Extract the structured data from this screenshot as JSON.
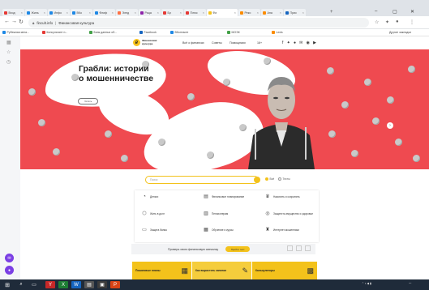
{
  "browser": {
    "tabs": [
      {
        "label": "Вход",
        "color": "#e53935"
      },
      {
        "label": "Жиль",
        "color": "#1e88e5"
      },
      {
        "label": "Инфо",
        "color": "#1e88e5"
      },
      {
        "label": "ВКо",
        "color": "#1e88e5"
      },
      {
        "label": "Флиф",
        "color": "#1e88e5"
      },
      {
        "label": "Элед",
        "color": "#ff7043"
      },
      {
        "label": "Раца",
        "color": "#8e24aa"
      },
      {
        "label": "Бр",
        "color": "#e53935"
      },
      {
        "label": "Плюс",
        "color": "#e53935"
      },
      {
        "label": "Фи",
        "color": "#f3c21b"
      },
      {
        "label": "Реко",
        "color": "#fb8c00"
      },
      {
        "label": "Ана",
        "color": "#fb8c00"
      },
      {
        "label": "Прис",
        "color": "#1565c0"
      }
    ],
    "new_tab": "+",
    "url_domain": "fincult.info",
    "url_separator": "|",
    "url_title": "Финансовая культура",
    "bookmarks": [
      {
        "label": "Рубежная мега...",
        "color": "#1e88e5"
      },
      {
        "label": "Консультант п...",
        "color": "#e53935"
      },
      {
        "label": "Банк данных об...",
        "color": "#43a047"
      },
      {
        "label": "Facebook",
        "color": "#1565c0"
      },
      {
        "label": "ВКонтакте",
        "color": "#1e88e5"
      },
      {
        "label": "МОЭК",
        "color": "#43a047"
      },
      {
        "label": "Lexis",
        "color": "#fb8c00"
      }
    ],
    "other_bookmarks": "Другие закладки"
  },
  "site": {
    "logo_mark": "₽",
    "logo_line1": "Финансовая",
    "logo_line2": "культура",
    "nav": [
      "Всё о финансах",
      "Советы",
      "Помощники",
      "16+"
    ],
    "social": "f ✦ ● ✉ ◉ ▶",
    "hero": {
      "title_line1": "Грабли: истории",
      "title_line2": "о мошенничестве",
      "button": "Читать"
    },
    "search": {
      "placeholder": "Поиск",
      "options": [
        "Всё",
        "Тесты"
      ]
    },
    "categories": [
      {
        "icon": "◔",
        "label": "Деньги"
      },
      {
        "icon": "▤",
        "label": "Финансовое планирование"
      },
      {
        "icon": "♛",
        "label": "Накопить и сохранить"
      },
      {
        "icon": "⬡",
        "label": "Жить в долг"
      },
      {
        "icon": "▥",
        "label": "Пенсионерам"
      },
      {
        "icon": "◎",
        "label": "Защитить имущество и здоровье"
      },
      {
        "icon": "▭",
        "label": "Защита банка"
      },
      {
        "icon": "▦",
        "label": "Обучение и курсы"
      },
      {
        "icon": "♜",
        "label": "Интернет-мошенники"
      }
    ],
    "test": {
      "label": "Проверь свою финансовую смекалку",
      "button": "Пройти тест"
    },
    "promos": [
      {
        "label": "Пошаговые планы",
        "icon": "▦"
      },
      {
        "label": "Как вырастить капитал",
        "icon": "✎"
      },
      {
        "label": "Калькуляторы",
        "icon": "▩"
      }
    ]
  },
  "colors": {
    "hero_red": "#ef4a50",
    "brand_yellow": "#f3c21b"
  }
}
